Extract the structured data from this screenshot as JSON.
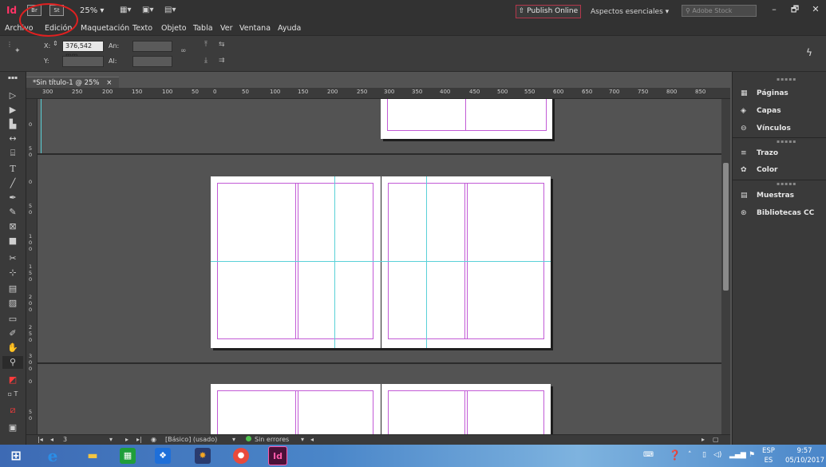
{
  "titlebar": {
    "logo": "Id",
    "bridge": "Br",
    "stock": "St",
    "zoom": "25% ▾",
    "publish_label": "Publish Online",
    "workspace": "Aspectos esenciales ▾",
    "search_placeholder": "Adobe Stock",
    "minimize": "–",
    "maximize": "🗗",
    "close": "✕"
  },
  "menu": [
    "Archivo",
    "Edición",
    "Maquetación",
    "Texto",
    "Objeto",
    "Tabla",
    "Ver",
    "Ventana",
    "Ayuda"
  ],
  "control": {
    "x_label": "X:",
    "x_value": "376,542 mm",
    "y_label": "Y:",
    "y_value": "",
    "w_label": "An:",
    "w_value": "",
    "h_label": "Al:",
    "h_value": ""
  },
  "document": {
    "tab_title": "*Sin título-1 @ 25%",
    "tab_close": "×",
    "ruler_h": [
      "300",
      "250",
      "200",
      "150",
      "100",
      "50",
      "0",
      "50",
      "100",
      "150",
      "200",
      "250",
      "300",
      "350",
      "400",
      "450",
      "500",
      "550",
      "600",
      "650",
      "700",
      "750",
      "800",
      "850"
    ],
    "ruler_v": [
      "0",
      "5 0",
      "0",
      "5 0",
      "1 0 0",
      "1 5 0",
      "2 0 0",
      "2 5 0",
      "3 0 0",
      "0",
      "5 0"
    ]
  },
  "status": {
    "first": "|◂",
    "prev": "◂",
    "page": "3",
    "next": "▸",
    "last": "▸|",
    "style": "[Básico] (usado)",
    "errors": "Sin errores"
  },
  "panels": [
    {
      "icon": "pages-icon",
      "glyph": "▦",
      "label": "Páginas"
    },
    {
      "icon": "layers-icon",
      "glyph": "◈",
      "label": "Capas"
    },
    {
      "icon": "links-icon",
      "glyph": "⊖",
      "label": "Vínculos"
    },
    {
      "icon": "stroke-icon",
      "glyph": "≡",
      "label": "Trazo"
    },
    {
      "icon": "color-icon",
      "glyph": "✿",
      "label": "Color"
    },
    {
      "icon": "swatches-icon",
      "glyph": "▤",
      "label": "Muestras"
    },
    {
      "icon": "cc-libraries-icon",
      "glyph": "⊛",
      "label": "Bibliotecas CC"
    }
  ],
  "taskbar": {
    "indesign": "Id",
    "lang_top": "ESP",
    "lang_bottom": "ES",
    "time": "9:57",
    "date": "05/10/2017"
  },
  "colors": {
    "margin": "#c25ad6",
    "guide": "#5ad1d8",
    "annotation": "#e02020"
  }
}
